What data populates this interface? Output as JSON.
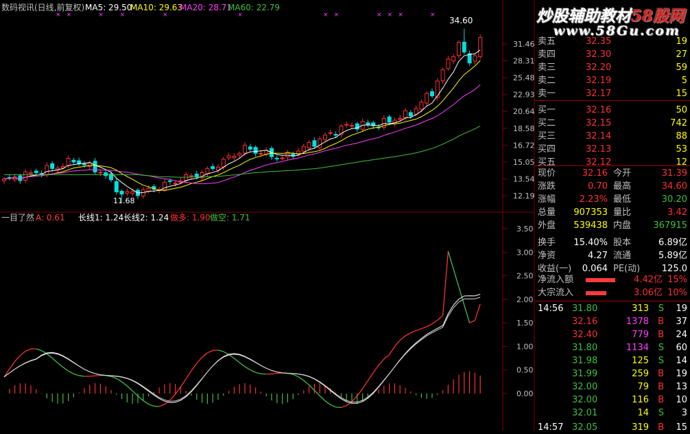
{
  "colors": {
    "up": "#ff3030",
    "down": "#00e0e0",
    "white": "#ffffff",
    "yellow": "#ffff00",
    "magenta": "#ff40ff",
    "green": "#40c040",
    "label": "#c0c0c0",
    "grid": "#800000",
    "red_panel": "#ff3c3c"
  },
  "watermark": {
    "line1_a": "炒股辅助教材",
    "line1_b": "58股网",
    "line2": "www.58Gu.com"
  },
  "main_chart": {
    "header": {
      "title": "数码视讯(日线,前复权)",
      "ma5": "MA5: 29.50",
      "ma10": "MA10: 29.63",
      "ma20": "MA20: 28.71",
      "ma60": "MA60: 22.79"
    },
    "price_ticks": [
      "31.46",
      "28.31",
      "25.48",
      "22.93",
      "20.64",
      "18.58",
      "16.72",
      "15.05",
      "13.54",
      "12.19"
    ],
    "high_label": "34.60",
    "low_label": "11.68"
  },
  "sub_chart": {
    "header": {
      "name": "一目了然",
      "a": "A: 0.61",
      "long1": "长线1: 1.24",
      "long2": "长线2: 1.24",
      "duo": "做多: 1.90",
      "kong": "做空: 1.71"
    },
    "ticks": [
      "3.50",
      "3.00",
      "2.50",
      "2.00",
      "1.50",
      "1.00",
      "0.50",
      "0.00"
    ]
  },
  "order_book": {
    "asks": [
      {
        "label": "卖五",
        "price": "32.35",
        "vol": "19"
      },
      {
        "label": "卖四",
        "price": "32.30",
        "vol": "27"
      },
      {
        "label": "卖三",
        "price": "32.20",
        "vol": "59"
      },
      {
        "label": "卖二",
        "price": "32.19",
        "vol": "5"
      },
      {
        "label": "卖一",
        "price": "32.17",
        "vol": "15"
      }
    ],
    "bids": [
      {
        "label": "买一",
        "price": "32.16",
        "vol": "50"
      },
      {
        "label": "买二",
        "price": "32.15",
        "vol": "742"
      },
      {
        "label": "买三",
        "price": "32.14",
        "vol": "88"
      },
      {
        "label": "买四",
        "price": "32.13",
        "vol": "53"
      },
      {
        "label": "买五",
        "price": "32.12",
        "vol": "12"
      }
    ]
  },
  "quote": {
    "rows": [
      {
        "l1": "现价",
        "v1": "32.16",
        "l2": "今开",
        "v2": "31.39"
      },
      {
        "l1": "涨跌",
        "v1": "0.70",
        "l2": "最高",
        "v2": "34.60"
      },
      {
        "l1": "涨幅",
        "v1": "2.23%",
        "l2": "最低",
        "v2": "30.20"
      },
      {
        "l1": "总量",
        "v1": "907353",
        "l2": "量比",
        "v2": "3.42"
      },
      {
        "l1": "外盘",
        "v1": "539438",
        "l2": "内盘",
        "v2": "367915"
      },
      {
        "l1": "换手",
        "v1": "15.40%",
        "l2": "股本",
        "v2": "6.89亿"
      },
      {
        "l1": "净资",
        "v1": "4.27",
        "l2": "流通",
        "v2": "5.89亿"
      },
      {
        "l1": "收益(一)",
        "v1": "0.064",
        "l2": "PE(动)",
        "v2": "125.0"
      }
    ],
    "flows": [
      {
        "label": "净流入额",
        "value": "4.42亿",
        "pct": "15%",
        "bar": 0.72
      },
      {
        "label": "大宗流入",
        "value": "3.06亿",
        "pct": "10%",
        "bar": 0.5
      }
    ]
  },
  "trades": [
    {
      "time": "14:56",
      "price": "31.80",
      "vol": "313",
      "bs": "S",
      "n": "19"
    },
    {
      "time": "",
      "price": "32.16",
      "vol": "1378",
      "bs": "B",
      "n": "37"
    },
    {
      "time": "",
      "price": "32.40",
      "vol": "779",
      "bs": "B",
      "n": "24"
    },
    {
      "time": "",
      "price": "31.80",
      "vol": "1134",
      "bs": "S",
      "n": "60"
    },
    {
      "time": "",
      "price": "31.98",
      "vol": "125",
      "bs": "S",
      "n": "14"
    },
    {
      "time": "",
      "price": "31.99",
      "vol": "259",
      "bs": "B",
      "n": "19"
    },
    {
      "time": "",
      "price": "32.00",
      "vol": "79",
      "bs": "B",
      "n": "13"
    },
    {
      "time": "",
      "price": "32.00",
      "vol": "116",
      "bs": "B",
      "n": "10"
    },
    {
      "time": "",
      "price": "32.01",
      "vol": "14",
      "bs": "S",
      "n": "3"
    },
    {
      "time": "14:57",
      "price": "32.05",
      "vol": "319",
      "bs": "B",
      "n": "15"
    }
  ]
}
